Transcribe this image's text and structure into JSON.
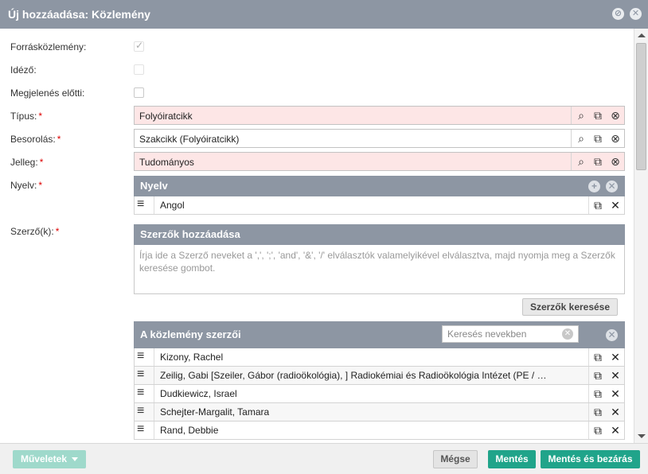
{
  "window": {
    "title": "Új hozzáadása: Közlemény"
  },
  "form": {
    "forraskozlemeny_label": "Forrásközlemény:",
    "idezo_label": "Idéző:",
    "megjelenes_label": "Megjelenés előtti:",
    "tipus_label": "Típus:",
    "tipus_value": "Folyóiratcikk",
    "besorolas_label": "Besorolás:",
    "besorolas_value": "Szakcikk (Folyóiratcikk)",
    "jelleg_label": "Jelleg:",
    "jelleg_value": "Tudományos",
    "nyelv_label": "Nyelv:",
    "szerzok_label": "Szerző(k):",
    "required_mark": "*"
  },
  "nyelv_panel": {
    "title": "Nyelv",
    "items": [
      {
        "label": "Angol"
      }
    ]
  },
  "add_authors": {
    "title": "Szerzők hozzáadása",
    "placeholder": "Írja ide a Szerző neveket a ',', ';', 'and', '&', '/' elválasztók valamelyikével elválasztva, majd nyomja meg a Szerzők keresése gombot.",
    "search_button": "Szerzők keresése"
  },
  "authors_panel": {
    "title": "A közlemény szerzői",
    "search_placeholder": "Keresés nevekben",
    "authors": [
      {
        "name": "Kizony, Rachel"
      },
      {
        "name": "Zeilig, Gabi [Szeiler, Gábor (radioökológia), ] Radiokémiai és Radioökológia Intézet (PE / …"
      },
      {
        "name": "Dudkiewicz, Israel"
      },
      {
        "name": "Schejter-Margalit, Tamara"
      },
      {
        "name": "Rand, Debbie"
      }
    ]
  },
  "footer": {
    "operations": "Műveletek",
    "cancel": "Mégse",
    "save": "Mentés",
    "save_close": "Mentés és bezárás"
  },
  "colors": {
    "header": "#8d96a3",
    "accent": "#20a48a",
    "required_bg": "#fde6e6"
  }
}
